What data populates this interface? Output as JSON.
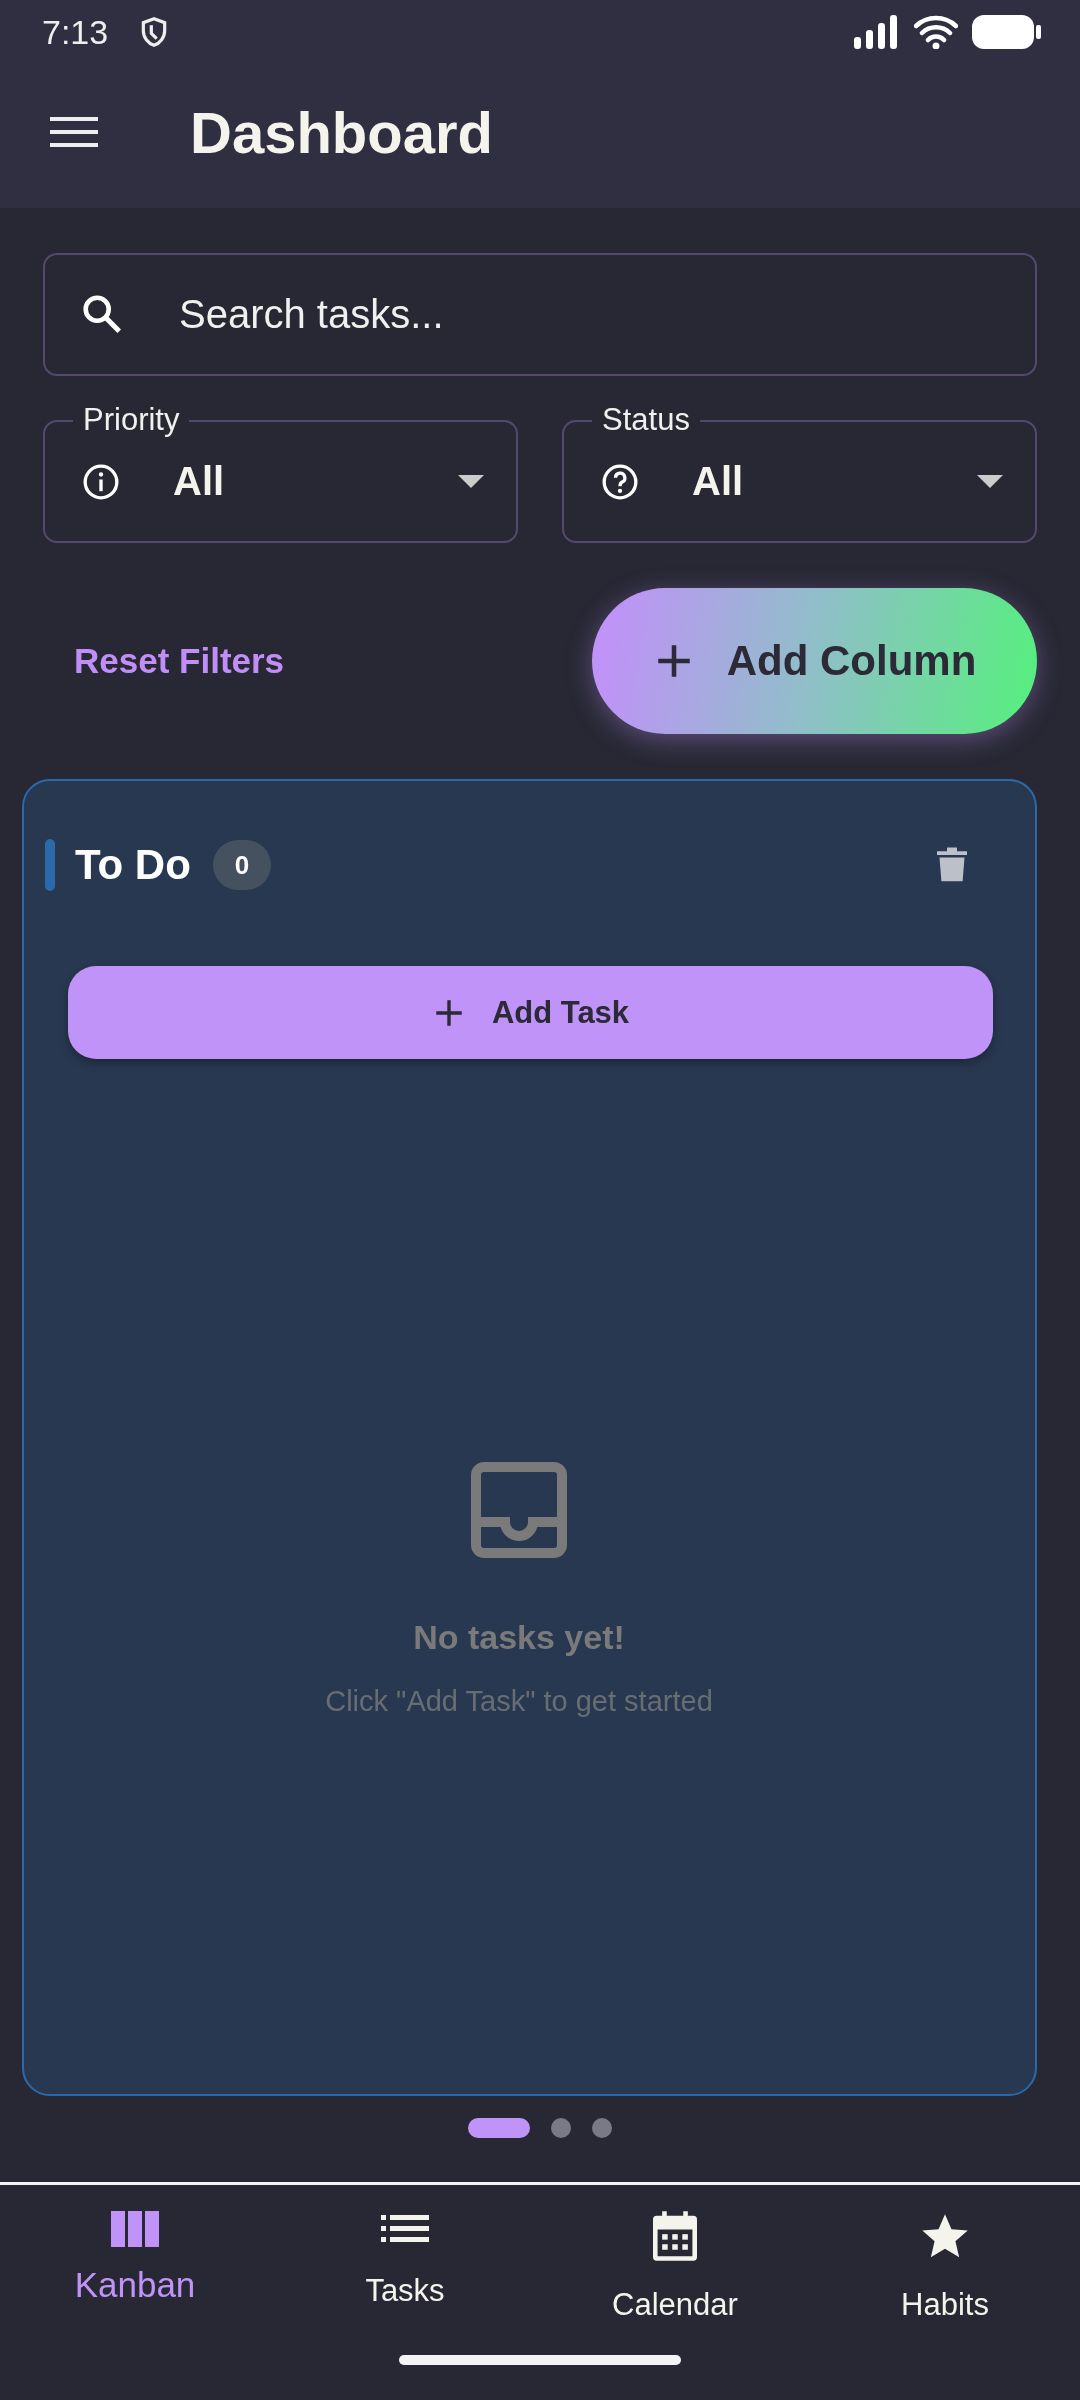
{
  "status_bar": {
    "time": "7:13"
  },
  "header": {
    "title": "Dashboard"
  },
  "search": {
    "placeholder": "Search tasks..."
  },
  "filters": [
    {
      "kind": "info",
      "label": "Priority",
      "value": "All"
    },
    {
      "kind": "help",
      "label": "Status",
      "value": "All"
    }
  ],
  "reset_filters": "Reset Filters",
  "add_column": "Add Column",
  "column": {
    "title": "To Do",
    "count": "0",
    "add_task": "Add Task",
    "empty_title": "No tasks yet!",
    "empty_subtitle": "Click \"Add Task\" to get started"
  },
  "page_indicator": [
    {
      "selected": true
    },
    {
      "selected": false
    },
    {
      "selected": false
    }
  ],
  "bottom_nav": [
    {
      "kind": "kanban",
      "label": "Kanban",
      "selected": true
    },
    {
      "kind": "list",
      "label": "Tasks",
      "selected": false
    },
    {
      "kind": "calendar",
      "label": "Calendar",
      "selected": false
    },
    {
      "kind": "star",
      "label": "Habits",
      "selected": false
    }
  ]
}
